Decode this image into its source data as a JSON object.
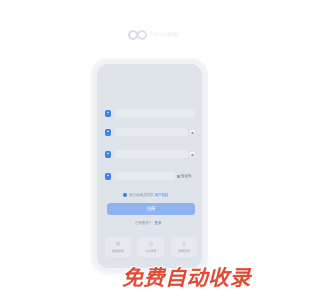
{
  "logo": {
    "text": "Fenxiang"
  },
  "form": {
    "rows": [
      {
        "icon": "user-icon",
        "placeholder": "",
        "trail": ""
      },
      {
        "icon": "lock-icon",
        "placeholder": "",
        "trail": "eye-icon"
      },
      {
        "icon": "lock-icon",
        "placeholder": "",
        "trail": "eye-icon"
      },
      {
        "icon": "shield-icon",
        "placeholder": "",
        "trail": "captcha"
      }
    ],
    "captcha_text": "验证码",
    "agree_text": "我已阅读并同意",
    "agree_link": "用户协议",
    "register_label": "注册",
    "login_prompt": "已有账号？",
    "login_link": "登录"
  },
  "apps": [
    {
      "icon": "wechat-icon",
      "glyph": "◎",
      "label": "微信登录"
    },
    {
      "icon": "qq-icon",
      "glyph": "◇",
      "label": "QQ登录"
    },
    {
      "icon": "weibo-icon",
      "glyph": "△",
      "label": "微博登录"
    }
  ],
  "banner": {
    "text": "免费自动收录"
  },
  "colors": {
    "accent": "#3c82f0",
    "button": "#8fb3f0",
    "banner": "#e14b36"
  }
}
